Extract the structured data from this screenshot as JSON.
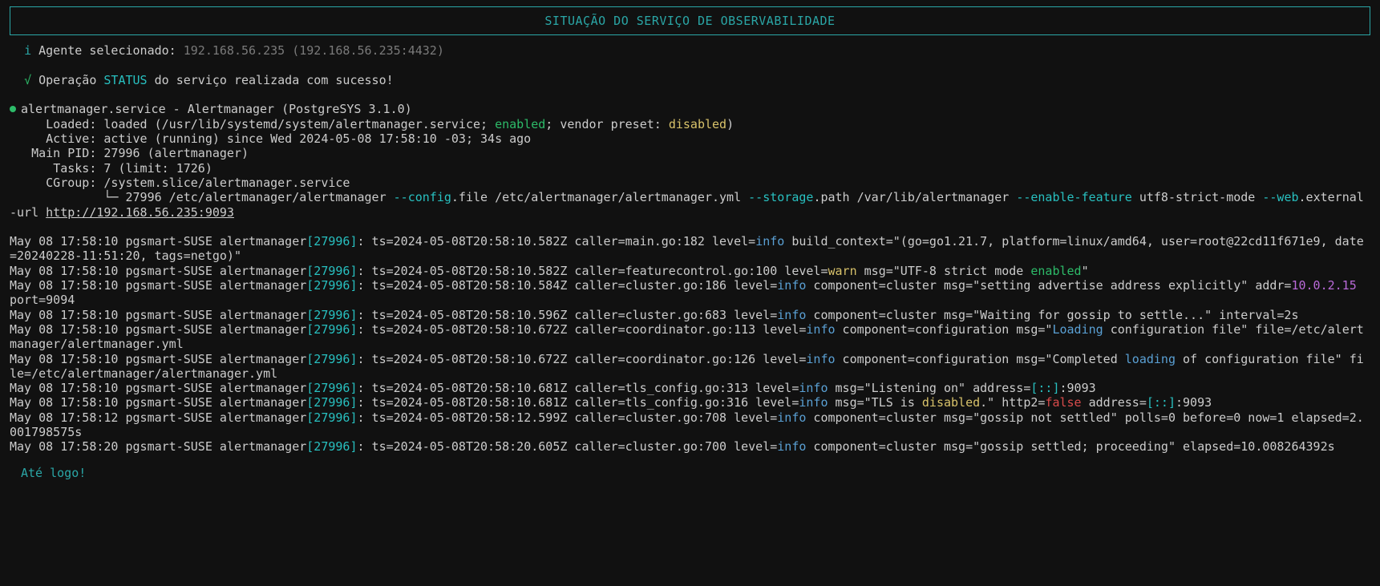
{
  "title": "SITUAÇÃO DO SERVIÇO DE OBSERVABILIDADE",
  "agent_prefix_icon": "i",
  "agent_label": "Agente selecionado:",
  "agent_value": "192.168.56.235 (192.168.56.235:4432)",
  "op_check": "√",
  "op_text_1": "Operação ",
  "op_status": "STATUS",
  "op_text_2": " do serviço realizada com sucesso!",
  "svc_line": "alertmanager.service - Alertmanager (PostgreSYS 3.1.0)",
  "svc_loaded_1": "     Loaded: loaded (/usr/lib/systemd/system/alertmanager.service; ",
  "svc_loaded_enabled": "enabled",
  "svc_loaded_2": "; vendor preset: ",
  "svc_loaded_disabled": "disabled",
  "svc_loaded_3": ")",
  "svc_active": "     Active: active (running) since Wed 2024-05-08 17:58:10 -03; 34s ago",
  "svc_pid": "   Main PID: 27996 (alertmanager)",
  "svc_tasks": "      Tasks: 7 (limit: 1726)",
  "svc_cgroup": "     CGroup: /system.slice/alertmanager.service",
  "svc_tree_1a": "             └─ 27996 /etc/alertmanager/alertmanager ",
  "svc_tree_cfg": "--config",
  "svc_tree_1b": ".file /etc/alertmanager/alertmanager.yml ",
  "svc_tree_storage": "--storage",
  "svc_tree_1c": ".path /var/lib/alertmanager ",
  "svc_tree_feat": "--enable-feature",
  "svc_tree_1d": " utf8-strict-mode ",
  "svc_tree_web": "--web",
  "svc_tree_1e": ".external-url ",
  "svc_url": "http://192.168.56.235:9093",
  "logs": [
    {
      "ts": "May 08 17:58:10",
      "host": "pgsmart-SUSE",
      "proc": "alertmanager",
      "pid": "27996",
      "body": "ts=2024-05-08T20:58:10.582Z caller=main.go:182 level=",
      "lvl": "info",
      "tail": " build_context=\"(go=go1.21.7, platform=linux/amd64, user=root@22cd11f671e9, date=20240228-11:51:20, tags=netgo)\"",
      "extra": []
    },
    {
      "ts": "May 08 17:58:10",
      "host": "pgsmart-SUSE",
      "proc": "alertmanager",
      "pid": "27996",
      "body": "ts=2024-05-08T20:58:10.582Z caller=featurecontrol.go:100 level=",
      "lvl": "warn",
      "tail": " msg=\"UTF-8 strict mode ",
      "extra": [
        {
          "cls": "c-green",
          "txt": "enabled"
        },
        {
          "cls": "c-white",
          "txt": "\""
        }
      ]
    },
    {
      "ts": "May 08 17:58:10",
      "host": "pgsmart-SUSE",
      "proc": "alertmanager",
      "pid": "27996",
      "body": "ts=2024-05-08T20:58:10.584Z caller=cluster.go:186 level=",
      "lvl": "info",
      "tail": " component=cluster msg=\"setting advertise address explicitly\" addr=",
      "extra": [
        {
          "cls": "c-mag",
          "txt": "10.0.2.15"
        },
        {
          "cls": "c-white",
          "txt": " port=9094"
        }
      ]
    },
    {
      "ts": "May 08 17:58:10",
      "host": "pgsmart-SUSE",
      "proc": "alertmanager",
      "pid": "27996",
      "body": "ts=2024-05-08T20:58:10.596Z caller=cluster.go:683 level=",
      "lvl": "info",
      "tail": " component=cluster msg=\"Waiting for gossip to settle...\" interval=2s",
      "extra": []
    },
    {
      "ts": "May 08 17:58:10",
      "host": "pgsmart-SUSE",
      "proc": "alertmanager",
      "pid": "27996",
      "body": "ts=2024-05-08T20:58:10.672Z caller=coordinator.go:113 level=",
      "lvl": "info",
      "tail": " component=configuration msg=\"",
      "extra": [
        {
          "cls": "c-blue",
          "txt": "Loading"
        },
        {
          "cls": "c-white",
          "txt": " configuration file\" file=/etc/alertmanager/alertmanager.yml"
        }
      ]
    },
    {
      "ts": "May 08 17:58:10",
      "host": "pgsmart-SUSE",
      "proc": "alertmanager",
      "pid": "27996",
      "body": "ts=2024-05-08T20:58:10.672Z caller=coordinator.go:126 level=",
      "lvl": "info",
      "tail": " component=configuration msg=\"Completed ",
      "extra": [
        {
          "cls": "c-blue",
          "txt": "loading"
        },
        {
          "cls": "c-white",
          "txt": " of configuration file\" file=/etc/alertmanager/alertmanager.yml"
        }
      ]
    },
    {
      "ts": "May 08 17:58:10",
      "host": "pgsmart-SUSE",
      "proc": "alertmanager",
      "pid": "27996",
      "body": "ts=2024-05-08T20:58:10.681Z caller=tls_config.go:313 level=",
      "lvl": "info",
      "tail": " msg=\"Listening on\" address=",
      "extra": [
        {
          "cls": "c-cyan",
          "txt": "[::]"
        },
        {
          "cls": "c-white",
          "txt": ":9093"
        }
      ]
    },
    {
      "ts": "May 08 17:58:10",
      "host": "pgsmart-SUSE",
      "proc": "alertmanager",
      "pid": "27996",
      "body": "ts=2024-05-08T20:58:10.681Z caller=tls_config.go:316 level=",
      "lvl": "info",
      "tail": " msg=\"TLS is ",
      "extra": [
        {
          "cls": "c-yellow",
          "txt": "disabled"
        },
        {
          "cls": "c-white",
          "txt": ".\" http2="
        },
        {
          "cls": "c-red",
          "txt": "false"
        },
        {
          "cls": "c-white",
          "txt": " address="
        },
        {
          "cls": "c-cyan",
          "txt": "[::]"
        },
        {
          "cls": "c-white",
          "txt": ":9093"
        }
      ]
    },
    {
      "ts": "May 08 17:58:12",
      "host": "pgsmart-SUSE",
      "proc": "alertmanager",
      "pid": "27996",
      "body": "ts=2024-05-08T20:58:12.599Z caller=cluster.go:708 level=",
      "lvl": "info",
      "tail": " component=cluster msg=\"gossip not settled\" polls=0 before=0 now=1 elapsed=2.001798575s",
      "extra": []
    },
    {
      "ts": "May 08 17:58:20",
      "host": "pgsmart-SUSE",
      "proc": "alertmanager",
      "pid": "27996",
      "body": "ts=2024-05-08T20:58:20.605Z caller=cluster.go:700 level=",
      "lvl": "info",
      "tail": " component=cluster msg=\"gossip settled; proceeding\" elapsed=10.008264392s",
      "extra": []
    }
  ],
  "farewell": "Até logo!"
}
